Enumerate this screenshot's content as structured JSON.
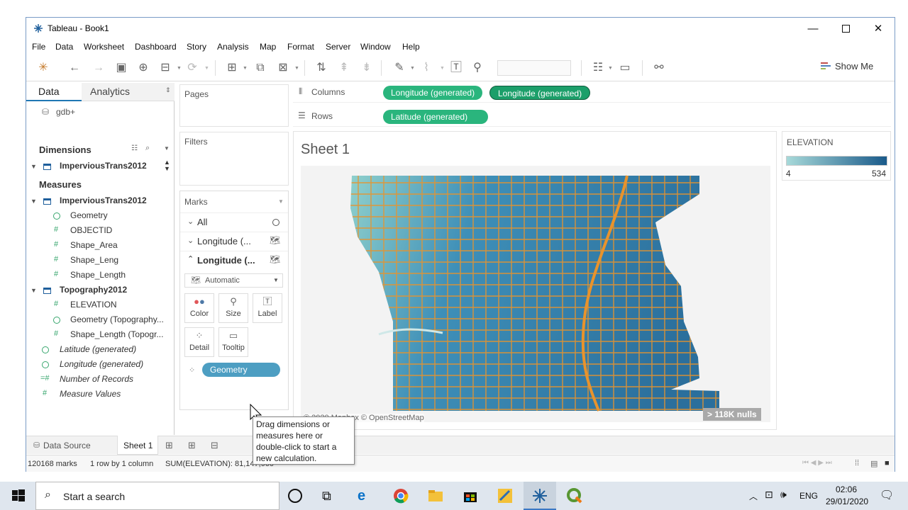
{
  "window": {
    "title": "Tableau - Book1",
    "minimize_icon": "minimize-icon",
    "maximize_icon": "maximize-icon",
    "close_icon": "close-icon"
  },
  "menu": [
    "File",
    "Data",
    "Worksheet",
    "Dashboard",
    "Story",
    "Analysis",
    "Map",
    "Format",
    "Server",
    "Window",
    "Help"
  ],
  "toolbar": {
    "show_me": "Show Me"
  },
  "data_pane": {
    "tab_data": "Data",
    "tab_analytics": "Analytics",
    "datasource": "gdb+",
    "dimensions_label": "Dimensions",
    "dimension_table": "ImperviousTrans2012",
    "measures_label": "Measures",
    "measure_table_1": "ImperviousTrans2012",
    "measure_fields_1": [
      "Geometry",
      "OBJECTID",
      "Shape_Area",
      "Shape_Leng",
      "Shape_Length"
    ],
    "measure_table_2": "Topography2012",
    "measure_fields_2": [
      "ELEVATION",
      "Geometry (Topography...",
      "Shape_Length (Topogr..."
    ],
    "generated_fields": [
      "Latitude (generated)",
      "Longitude (generated)",
      "Number of Records",
      "Measure Values"
    ]
  },
  "shelves": {
    "pages": "Pages",
    "filters": "Filters",
    "columns_label": "Columns",
    "rows_label": "Rows",
    "columns_pills": [
      "Longitude (generated)",
      "Longitude (generated)"
    ],
    "rows_pills": [
      "Latitude (generated)"
    ]
  },
  "marks": {
    "title": "Marks",
    "all": "All",
    "layer_1": "Longitude (...",
    "layer_2": "Longitude (...",
    "mark_type": "Automatic",
    "buttons": [
      "Color",
      "Size",
      "Label",
      "Detail",
      "Tooltip"
    ],
    "geometry_pill": "Geometry"
  },
  "view": {
    "sheet_title": "Sheet 1",
    "attribution": "© 2020 Mapbox © OpenStreetMap",
    "nulls": "> 118K nulls"
  },
  "legend": {
    "title": "ELEVATION",
    "min": "4",
    "max": "534",
    "color_low": "#a7d9d9",
    "color_high": "#1a5a8a"
  },
  "tooltip": {
    "text": "Drag dimensions or measures here or double-click to start a new calculation."
  },
  "sheet_tabs": {
    "data_source": "Data Source",
    "sheet": "Sheet 1"
  },
  "status": {
    "marks": "120168 marks",
    "dims": "1 row by 1 column",
    "sum": "SUM(ELEVATION): 81,147,960"
  },
  "taskbar": {
    "search_placeholder": "Start a search",
    "language": "ENG",
    "time": "02:06",
    "date": "29/01/2020"
  },
  "colors": {
    "pill_green": "#2ab57d",
    "pill_blue": "#4d9ec2",
    "road_orange": "#e8932c"
  }
}
